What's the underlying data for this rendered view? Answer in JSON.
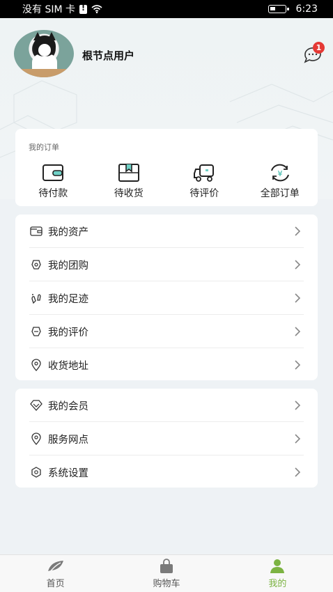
{
  "status_bar": {
    "carrier": "没有 SIM 卡",
    "time": "6:23"
  },
  "profile": {
    "username": "根节点用户",
    "message_badge": "1"
  },
  "orders": {
    "title": "我的订单",
    "items": [
      {
        "label": "待付款",
        "icon": "wallet-icon"
      },
      {
        "label": "待收货",
        "icon": "package-icon"
      },
      {
        "label": "待评价",
        "icon": "truck-icon"
      },
      {
        "label": "全部订单",
        "icon": "yuan-refresh-icon"
      }
    ]
  },
  "menu_group1": [
    {
      "label": "我的资产",
      "icon": "wallet-outline-icon"
    },
    {
      "label": "我的团购",
      "icon": "group-buy-icon"
    },
    {
      "label": "我的足迹",
      "icon": "footprint-icon"
    },
    {
      "label": "我的评价",
      "icon": "review-icon"
    },
    {
      "label": "收货地址",
      "icon": "location-pin-icon"
    }
  ],
  "menu_group2": [
    {
      "label": "我的会员",
      "icon": "diamond-icon"
    },
    {
      "label": "服务网点",
      "icon": "location-pin-icon"
    },
    {
      "label": "系统设置",
      "icon": "settings-icon"
    }
  ],
  "tabbar": {
    "tabs": [
      {
        "label": "首页",
        "icon": "leaf-icon"
      },
      {
        "label": "购物车",
        "icon": "bag-icon"
      },
      {
        "label": "我的",
        "icon": "person-icon"
      }
    ],
    "active_color": "#7cb342"
  }
}
